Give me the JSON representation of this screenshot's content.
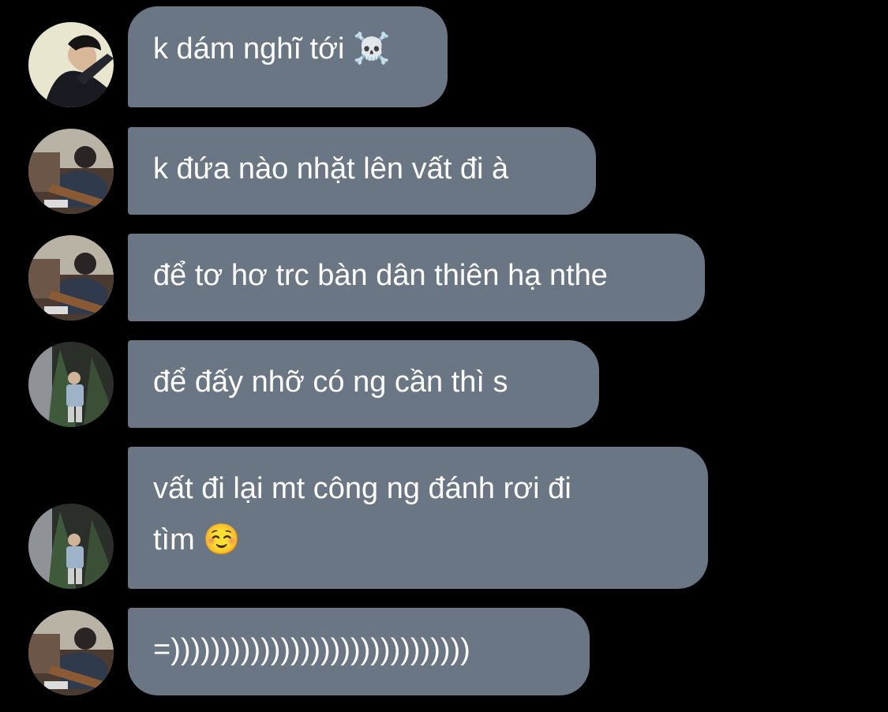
{
  "messages": [
    {
      "text": "k dám nghĩ tới",
      "emoji": "☠️",
      "avatar": "avatar-dark-jacket"
    },
    {
      "text": "k đứa nào nhặt lên vất đi à",
      "emoji": "",
      "avatar": "avatar-guitar-sofa"
    },
    {
      "text": "để tơ hơ trc bàn dân thiên hạ nthe",
      "emoji": "",
      "avatar": "avatar-guitar-sofa"
    },
    {
      "text": "để đấy nhỡ có ng cần thì s",
      "emoji": "",
      "avatar": "avatar-street-tree"
    },
    {
      "line1": "vất đi lại mt công ng đánh rơi đi",
      "line2": "tìm",
      "emoji": "☺️",
      "avatar": "avatar-street-tree"
    },
    {
      "text": "=))))))))))))))))))))))))))))))",
      "emoji": "",
      "avatar": "avatar-guitar-sofa"
    }
  ],
  "colors": {
    "background": "#000000",
    "bubble": "#6a7684",
    "text": "#ffffff"
  }
}
